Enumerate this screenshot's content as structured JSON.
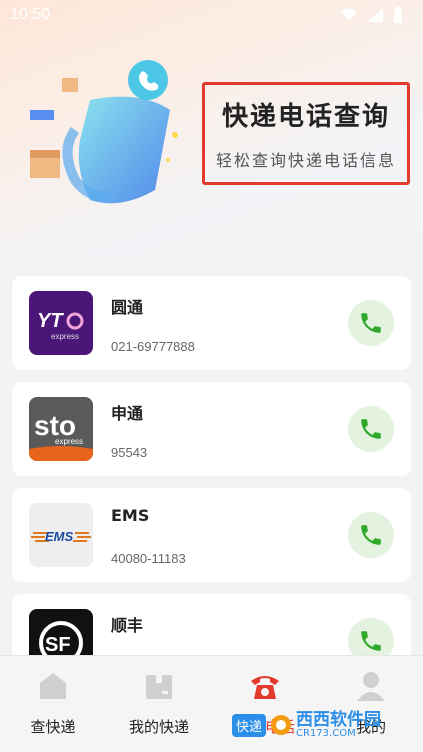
{
  "status_bar": {
    "time": "10:50"
  },
  "banner": {
    "title": "快递电话查询",
    "subtitle": "轻松查询快递电话信息"
  },
  "couriers": [
    {
      "name": "圆通",
      "phone": "021-69777888",
      "logo_text": "YTO",
      "logo_sub": "express"
    },
    {
      "name": "申通",
      "phone": "95543",
      "logo_text": "sto",
      "logo_sub": "express"
    },
    {
      "name": "EMS",
      "phone": "40080-11183",
      "logo_text": "EMS"
    },
    {
      "name": "顺丰",
      "phone": "",
      "logo_text": "SF"
    }
  ],
  "tabs": [
    {
      "label": "查快递",
      "icon": "box-icon"
    },
    {
      "label": "我的快递",
      "icon": "package-icon"
    },
    {
      "label": "快递电话",
      "icon": "telephone-icon"
    },
    {
      "label": "我的",
      "icon": "person-icon"
    }
  ],
  "watermark": {
    "text": "西西软件园",
    "sub": "CR173.COM",
    "tag": "快递"
  },
  "colors": {
    "accent_red": "#e23b2e",
    "call_green": "#2fa82c",
    "yto_purple": "#4a1678",
    "sto_orange": "#e8631c"
  }
}
